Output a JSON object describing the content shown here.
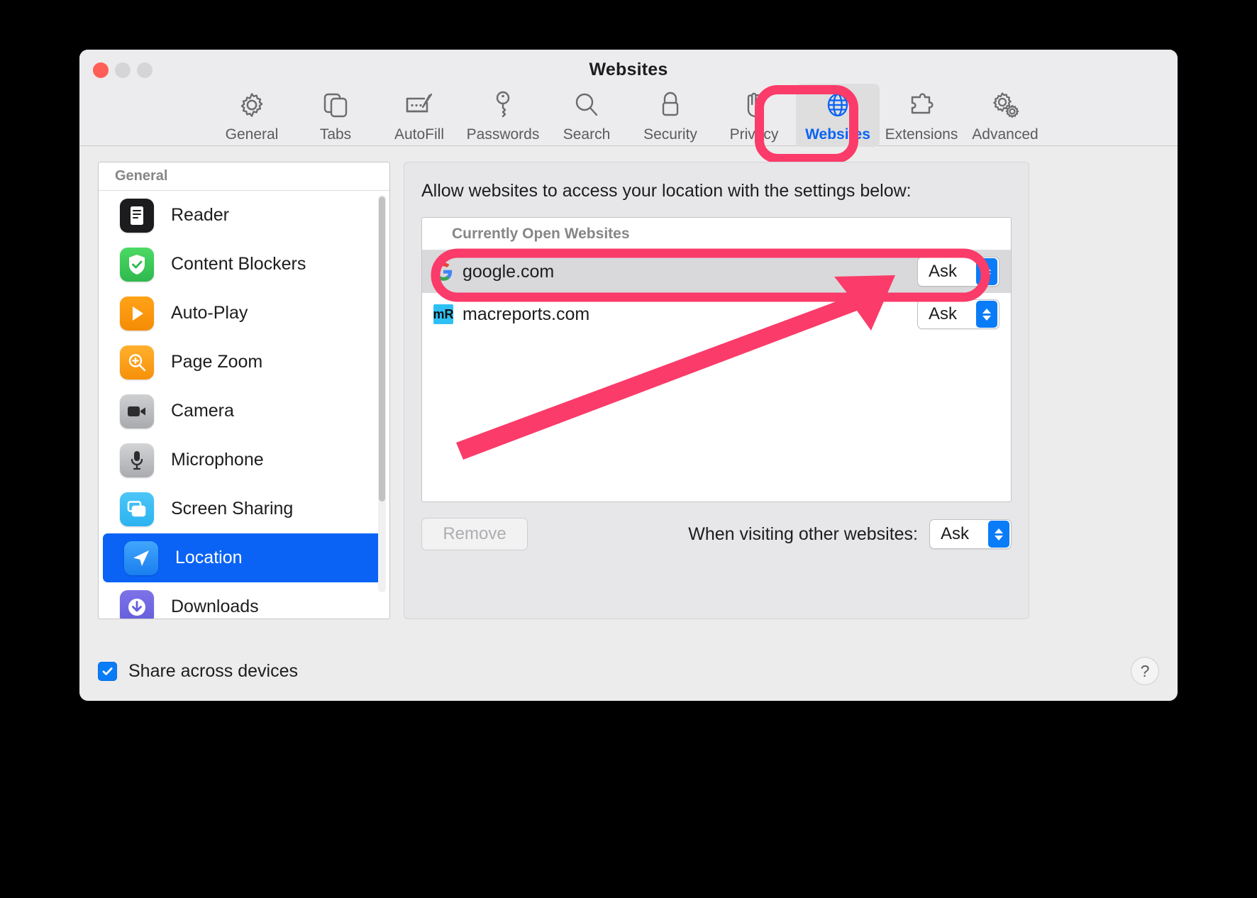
{
  "window": {
    "title": "Websites",
    "traffic_lights": [
      "close",
      "minimize",
      "zoom"
    ]
  },
  "toolbar": {
    "items": [
      {
        "label": "General",
        "icon": "gear-icon",
        "selected": false
      },
      {
        "label": "Tabs",
        "icon": "tabs-icon",
        "selected": false
      },
      {
        "label": "AutoFill",
        "icon": "autofill-icon",
        "selected": false
      },
      {
        "label": "Passwords",
        "icon": "key-icon",
        "selected": false
      },
      {
        "label": "Search",
        "icon": "search-icon",
        "selected": false
      },
      {
        "label": "Security",
        "icon": "lock-icon",
        "selected": false
      },
      {
        "label": "Privacy",
        "icon": "hand-icon",
        "selected": false
      },
      {
        "label": "Websites",
        "icon": "globe-icon",
        "selected": true
      },
      {
        "label": "Extensions",
        "icon": "puzzle-icon",
        "selected": false
      },
      {
        "label": "Advanced",
        "icon": "gears-icon",
        "selected": false
      }
    ]
  },
  "sidebar": {
    "header": "General",
    "items": [
      {
        "label": "Reader",
        "icon": "reader-icon",
        "selected": false
      },
      {
        "label": "Content Blockers",
        "icon": "shield-check-icon",
        "selected": false
      },
      {
        "label": "Auto-Play",
        "icon": "play-icon",
        "selected": false
      },
      {
        "label": "Page Zoom",
        "icon": "magnifier-plus-icon",
        "selected": false
      },
      {
        "label": "Camera",
        "icon": "camera-icon",
        "selected": false
      },
      {
        "label": "Microphone",
        "icon": "microphone-icon",
        "selected": false
      },
      {
        "label": "Screen Sharing",
        "icon": "screen-sharing-icon",
        "selected": false
      },
      {
        "label": "Location",
        "icon": "location-arrow-icon",
        "selected": true
      },
      {
        "label": "Downloads",
        "icon": "download-icon",
        "selected": false
      }
    ]
  },
  "main": {
    "lead": "Allow websites to access your location with the settings below:",
    "list_header": "Currently Open Websites",
    "rows": [
      {
        "site": "google.com",
        "favicon": "google-favicon",
        "permission": "Ask",
        "selected": true
      },
      {
        "site": "macreports.com",
        "favicon": "macreports-favicon",
        "favicon_text": "mR",
        "permission": "Ask",
        "selected": false
      }
    ],
    "remove_label": "Remove",
    "visiting_label": "When visiting other websites:",
    "visiting_value": "Ask"
  },
  "footer": {
    "share_label": "Share across devices",
    "share_checked": true,
    "help_label": "?"
  },
  "annotations": {
    "accent_color": "#fb3b69",
    "highlight_color": "#0a63f5",
    "rings": [
      "websites-tab",
      "location-sidebar-item",
      "google-row"
    ],
    "arrow": "points-to-google-permission-popup"
  }
}
